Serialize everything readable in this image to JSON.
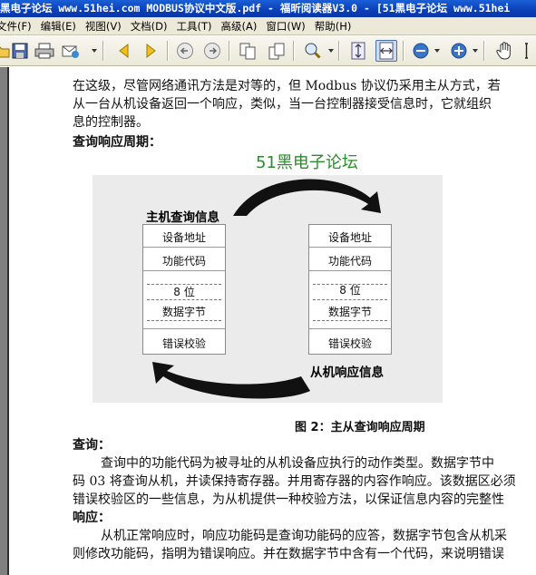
{
  "window": {
    "title": "黑电子论坛 www.51hei.com MODBUS协议中文版.pdf - 福昕阅读器V3.0 - [51黑电子论坛 www.51hei"
  },
  "menu": [
    "文件(F)",
    "编辑(E)",
    "视图(V)",
    "文档(D)",
    "工具(T)",
    "高级(A)",
    "窗口(W)",
    "帮助(H)"
  ],
  "toolbar": {
    "icons": [
      "open-folder-icon",
      "save-icon",
      "print-icon",
      "email-icon",
      "previous-page-icon",
      "next-page-icon",
      "back-icon",
      "forward-icon",
      "fit-width-icon",
      "fit-page-icon",
      "zoom-tool-icon",
      "fit-window-icon",
      "fit-visible-icon",
      "zoom-out-icon",
      "zoom-in-icon",
      "hand-tool-icon",
      "select-text-icon"
    ]
  },
  "document": {
    "para1": [
      "在这级，尽管网络通讯方法是对等的，但 Modbus 协议仍采用主从方式，若",
      "从一台从机设备返回一个响应，类似，当一台控制器接受信息时，它就组织",
      "息的控制器。"
    ],
    "heading1": "查询响应周期：",
    "figure": {
      "watermark": "51黑电子论坛",
      "master_label": "主机查询信息",
      "slave_label": "从机响应信息",
      "left_box": [
        "设备地址",
        "功能代码",
        "8 位",
        "数据字节",
        "错误校验"
      ],
      "right_box": [
        "设备地址",
        "功能代码",
        "8 位",
        "数据字节",
        "错误校验"
      ],
      "caption": "图 2：主从查询响应周期"
    },
    "heading2": "查询：",
    "para2": [
      "查询中的功能代码为被寻址的从机设备应执行的动作类型。数据字节中",
      "码 03 将查询从机，并读保持寄存器。并用寄存器的内容作响应。该数据区必须",
      "错误校验区的一些信息，为从机提供一种校验方法，以保证信息内容的完整性"
    ],
    "heading3": "响应：",
    "para3": [
      "从机正常响应时，响应功能码是查询功能码的应答，数据字节包含从机采",
      "则修改功能码，指明为错误响应。并在数据字节中含有一个代码，来说明错误"
    ]
  },
  "colors": {
    "titlebar": "#0a3fb8",
    "menubar": "#ece9d8",
    "watermark": "#2d8a2d",
    "figure_bg": "#ebebeb"
  }
}
